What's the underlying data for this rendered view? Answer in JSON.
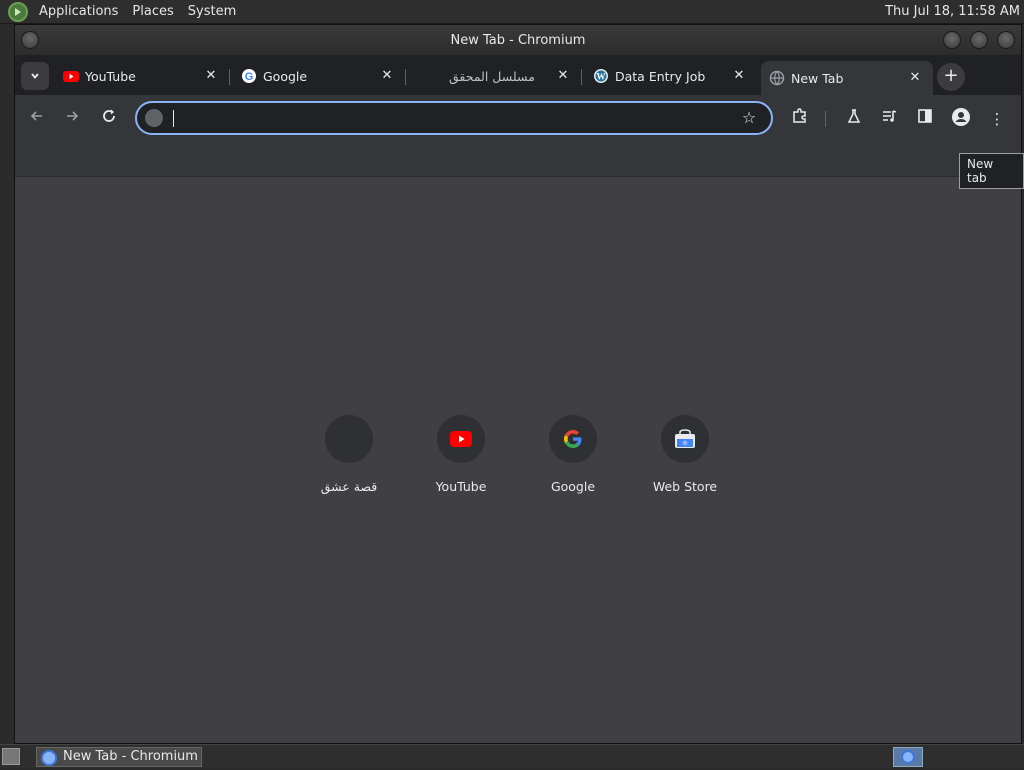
{
  "panel": {
    "menus": [
      "Applications",
      "Places",
      "System"
    ],
    "clock": "Thu Jul 18, 11:58 AM"
  },
  "window": {
    "title": "New Tab - Chromium"
  },
  "tabs": [
    {
      "label": "YouTube",
      "favicon": "youtube-icon"
    },
    {
      "label": "Google",
      "favicon": "google-icon"
    },
    {
      "label": "مسلسل المحقق",
      "favicon": "none"
    },
    {
      "label": "Data Entry Jobs -",
      "favicon": "wordpress-icon"
    },
    {
      "label": "New Tab",
      "favicon": "globe-icon",
      "active": true
    }
  ],
  "omnibox": {
    "value": "",
    "placeholder": ""
  },
  "tooltip": "New tab",
  "shortcuts": [
    {
      "label": "قصة عشق",
      "icon": "blank-icon"
    },
    {
      "label": "YouTube",
      "icon": "youtube-icon"
    },
    {
      "label": "Google",
      "icon": "google-icon"
    },
    {
      "label": "Web Store",
      "icon": "web-store-icon"
    }
  ],
  "taskbar": {
    "window_label": "New Tab - Chromium"
  },
  "colors": {
    "accent": "#8ab4f8",
    "content_bg": "#3f3f44",
    "toolbar_bg": "#35363a"
  }
}
